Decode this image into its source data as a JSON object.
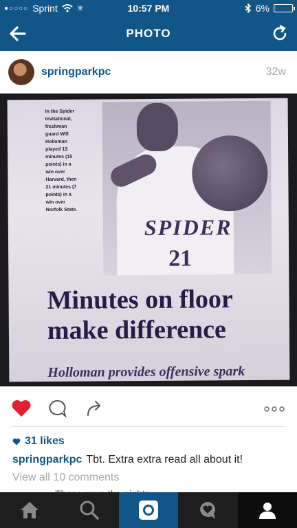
{
  "status_bar": {
    "carrier": "Sprint",
    "signal_dots": "●○○○○",
    "time": "10:57 PM",
    "battery_percent": "6%",
    "battery_level": 0.06
  },
  "nav": {
    "title": "PHOTO",
    "back_icon": "back-arrow-icon",
    "refresh_icon": "refresh-icon"
  },
  "post": {
    "username": "springparkpc",
    "time_ago": "32w",
    "photo": {
      "side_caption": "In the Spider\nInvitational,\nfreshman\nguard Will\nHolloman\nplayed 13\nminutes (15\npoints) in a\nwin over\nHarvard, then\n21 minutes (7\npoints) in a\nwin over\nNorfolk State.",
      "jersey_text": "SPIDER",
      "jersey_number": "21",
      "headline_line1": "Minutes on floor",
      "headline_line2": "make difference",
      "subhead": "Holloman provides offensive spark"
    },
    "likes": "31 likes",
    "caption_user": "springparkpc",
    "caption_text": "Tbt.  Extra extra read all about it!",
    "view_all": "View all 10 comments",
    "cut_comment": "Those were the nights ... "
  },
  "colors": {
    "brand": "#125688",
    "like_red": "#e0212f",
    "tabbar": "#1e1e1e"
  },
  "tabs": [
    "home-icon",
    "search-icon",
    "camera-icon",
    "activity-icon",
    "profile-icon"
  ]
}
